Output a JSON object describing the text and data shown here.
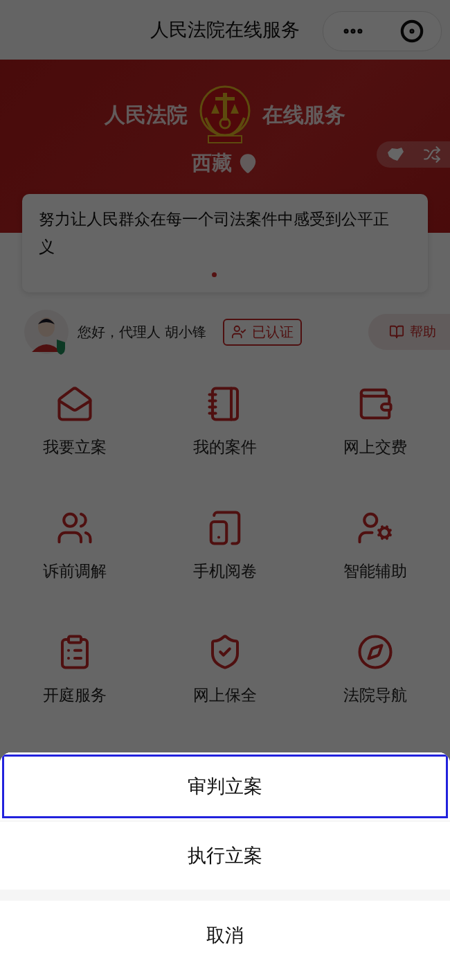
{
  "nav_bar": {
    "title": "人民法院在线服务"
  },
  "header": {
    "title_left": "人民法院",
    "title_right": "在线服务",
    "region": "西藏"
  },
  "banner": {
    "text": "努力让人民群众在每一个司法案件中感受到公平正义"
  },
  "user": {
    "greeting": "您好，代理人 胡小锋",
    "verified_label": "已认证",
    "help_label": "帮助"
  },
  "services": [
    {
      "label": "我要立案"
    },
    {
      "label": "我的案件"
    },
    {
      "label": "网上交费"
    },
    {
      "label": "诉前调解"
    },
    {
      "label": "手机阅卷"
    },
    {
      "label": "智能辅助"
    },
    {
      "label": "开庭服务"
    },
    {
      "label": "网上保全"
    },
    {
      "label": "法院导航"
    }
  ],
  "action_sheet": {
    "options": [
      {
        "label": "审判立案",
        "selected": true
      },
      {
        "label": "执行立案",
        "selected": false
      }
    ],
    "cancel": "取消"
  }
}
